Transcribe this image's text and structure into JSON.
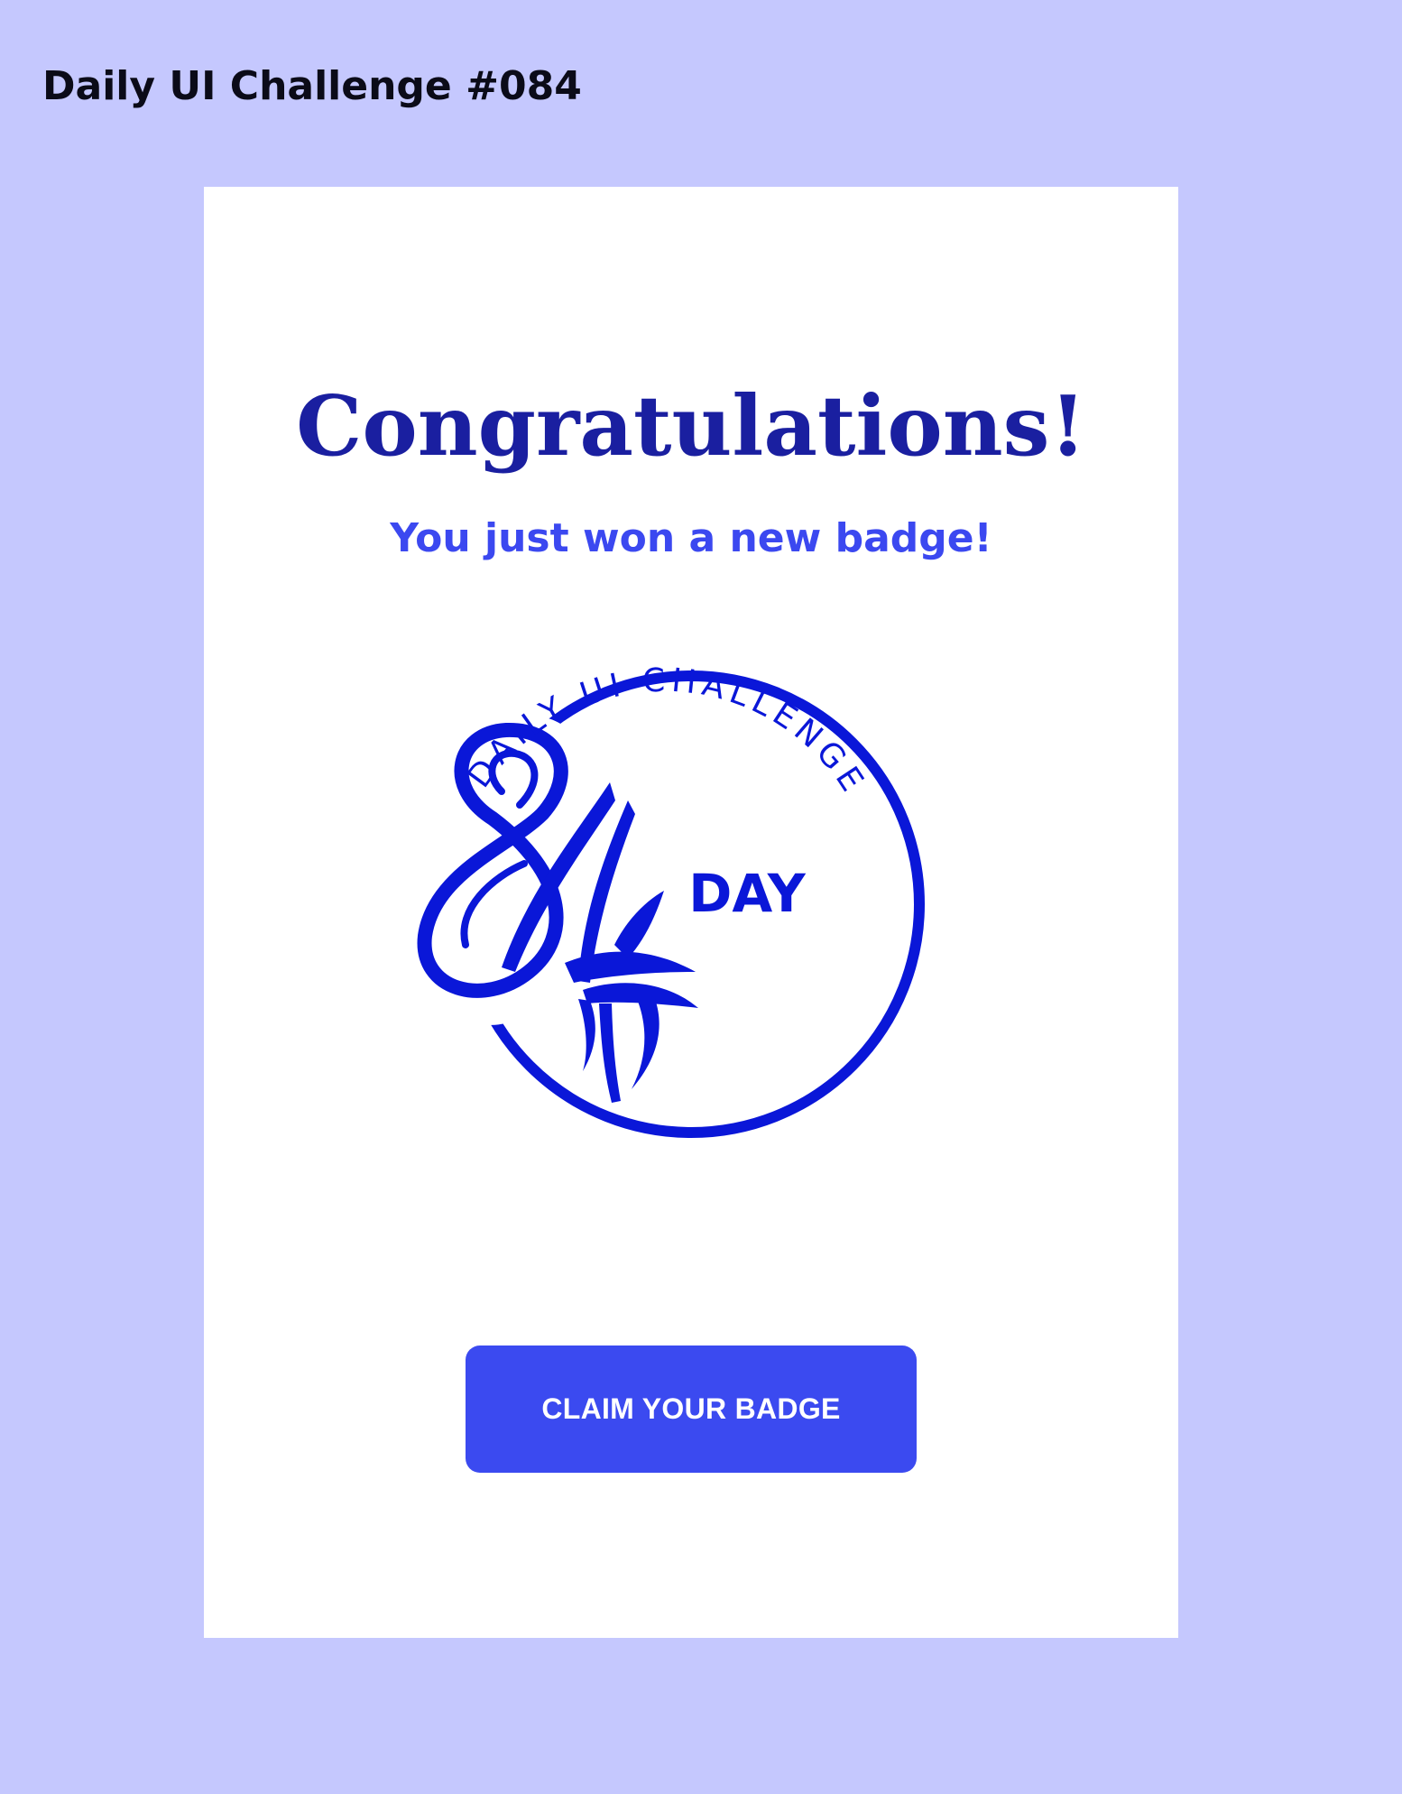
{
  "page": {
    "heading": "Daily UI Challenge #084"
  },
  "card": {
    "title": "Congratulations!",
    "subtitle": "You just won a new badge!",
    "badge": {
      "number": "84",
      "center_label": "DAY",
      "ring_text": "DAILY UI CHALLENGE",
      "color": "#0a17d8"
    },
    "cta_label": "CLAIM YOUR BADGE"
  },
  "colors": {
    "background": "#c5c8fe",
    "card": "#ffffff",
    "title": "#1a1fa0",
    "subtitle": "#3b48f0",
    "button": "#3b4af0",
    "button_text": "#ffffff"
  }
}
